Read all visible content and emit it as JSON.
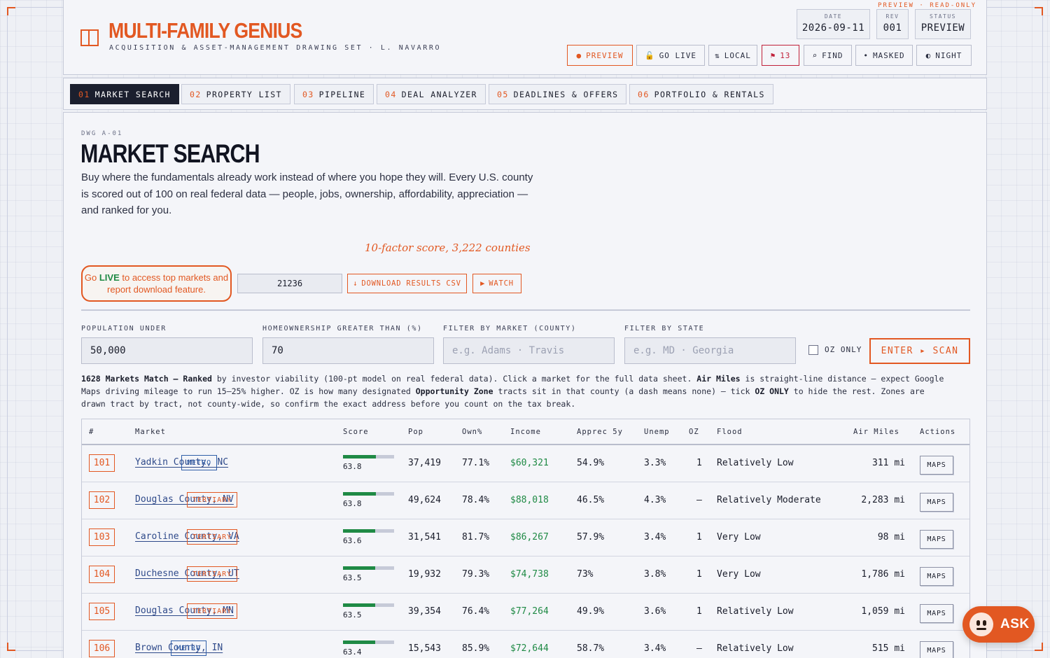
{
  "app": {
    "preview_tag": "PREVIEW · READ-ONLY",
    "title": "MULTI-FAMILY GENIUS",
    "subtitle": "ACQUISITION & ASSET-MANAGEMENT DRAWING SET · L. NAVARRO"
  },
  "meta": {
    "date_label": "DATE",
    "date_value": "2026-09-11",
    "rev_label": "REV",
    "rev_value": "001",
    "status_label": "STATUS",
    "status_value": "PREVIEW"
  },
  "toolbar": {
    "preview": "PREVIEW",
    "go_live": "GO LIVE",
    "local": "LOCAL",
    "flags": "13",
    "find": "FIND",
    "masked": "MASKED",
    "night": "NIGHT"
  },
  "tabs": [
    {
      "num": "01",
      "label": "MARKET SEARCH"
    },
    {
      "num": "02",
      "label": "PROPERTY LIST"
    },
    {
      "num": "03",
      "label": "PIPELINE"
    },
    {
      "num": "04",
      "label": "DEAL ANALYZER"
    },
    {
      "num": "05",
      "label": "DEADLINES & OFFERS"
    },
    {
      "num": "06",
      "label": "PORTFOLIO & RENTALS"
    }
  ],
  "page": {
    "dwg": "DWG A-01",
    "title": "MARKET SEARCH",
    "intro": "Buy where the fundamentals already work instead of where you hope they will. Every U.S. county is scored out of 100 on real federal data — people, jobs, ownership, affordability, appreciation — and ranked for you.",
    "annotation": "10-factor score, 3,222 counties",
    "golive_pre": "Go ",
    "golive_bold": "LIVE",
    "golive_post": " to access top markets and report download feature.",
    "zip_value": "21236",
    "download_label": "DOWNLOAD RESULTS CSV",
    "watch_label": "WATCH"
  },
  "filters": {
    "population_label": "POPULATION UNDER",
    "population_value": "50,000",
    "homeownership_label": "HOMEOWNERSHIP GREATER THAN (%)",
    "homeownership_value": "70",
    "market_label": "FILTER BY MARKET (COUNTY)",
    "market_placeholder": "e.g. Adams · Travis",
    "state_label": "FILTER BY STATE",
    "state_placeholder": "e.g. MD · Georgia",
    "oz_label": "OZ ONLY",
    "scan_label": "ENTER ▸ SCAN"
  },
  "explain": {
    "count": "1628 Markets Match — Ranked",
    "t1": " by investor viability (100-pt model on real federal data). Click a market for the full data sheet. ",
    "b2": "Air Miles",
    "t2": " is straight-line distance — expect Google Maps driving mileage to run 15–25% higher. OZ is how many designated ",
    "b3": "Opportunity Zone",
    "t3": " tracts sit in that county (a dash means none) — tick ",
    "b4": "OZ ONLY",
    "t4": " to hide the rest. Zones are drawn tract by tract, not county-wide, so confirm the exact address before you count on the tax break."
  },
  "table": {
    "headers": {
      "rank": "#",
      "market": "Market",
      "score": "Score",
      "pop": "Pop",
      "own": "Own%",
      "income": "Income",
      "apprec": "Apprec 5y",
      "unemp": "Unemp",
      "oz": "OZ",
      "flood": "Flood",
      "air": "Air Miles",
      "actions": "Actions"
    },
    "maps_label": "MAPS",
    "rows": [
      {
        "rank": "101",
        "market": "Yadkin County, NC",
        "tier": "METRO",
        "score": "63.8",
        "score_pct": 0.638,
        "pop": "37,419",
        "own": "77.1%",
        "income": "$60,321",
        "apprec": "54.9%",
        "unemp": "3.3%",
        "oz": "1",
        "flood": "Relatively Low",
        "air": "311 mi"
      },
      {
        "rank": "102",
        "market": "Douglas County, NV",
        "tier": "TERTIARY",
        "score": "63.8",
        "score_pct": 0.638,
        "pop": "49,624",
        "own": "78.4%",
        "income": "$88,018",
        "apprec": "46.5%",
        "unemp": "4.3%",
        "oz": "—",
        "flood": "Relatively Moderate",
        "air": "2,283 mi"
      },
      {
        "rank": "103",
        "market": "Caroline County, VA",
        "tier": "TERTIARY",
        "score": "63.6",
        "score_pct": 0.636,
        "pop": "31,541",
        "own": "81.7%",
        "income": "$86,267",
        "apprec": "57.9%",
        "unemp": "3.4%",
        "oz": "1",
        "flood": "Very Low",
        "air": "98 mi"
      },
      {
        "rank": "104",
        "market": "Duchesne County, UT",
        "tier": "TERTIARY",
        "score": "63.5",
        "score_pct": 0.635,
        "pop": "19,932",
        "own": "79.3%",
        "income": "$74,738",
        "apprec": "73%",
        "unemp": "3.8%",
        "oz": "1",
        "flood": "Very Low",
        "air": "1,786 mi"
      },
      {
        "rank": "105",
        "market": "Douglas County, MN",
        "tier": "TERTIARY",
        "score": "63.5",
        "score_pct": 0.635,
        "pop": "39,354",
        "own": "76.4%",
        "income": "$77,264",
        "apprec": "49.9%",
        "unemp": "3.6%",
        "oz": "1",
        "flood": "Relatively Low",
        "air": "1,059 mi"
      },
      {
        "rank": "106",
        "market": "Brown County, IN",
        "tier": "METRO",
        "score": "63.4",
        "score_pct": 0.634,
        "pop": "15,543",
        "own": "85.9%",
        "income": "$72,644",
        "apprec": "58.7%",
        "unemp": "3.4%",
        "oz": "—",
        "flood": "Relatively Low",
        "air": "515 mi"
      }
    ]
  },
  "ask": {
    "label": "ASK"
  },
  "colors": {
    "accent": "#e25822",
    "green": "#1f8a45",
    "ink": "#1b1f2e",
    "metro": "#2f5ea8"
  }
}
